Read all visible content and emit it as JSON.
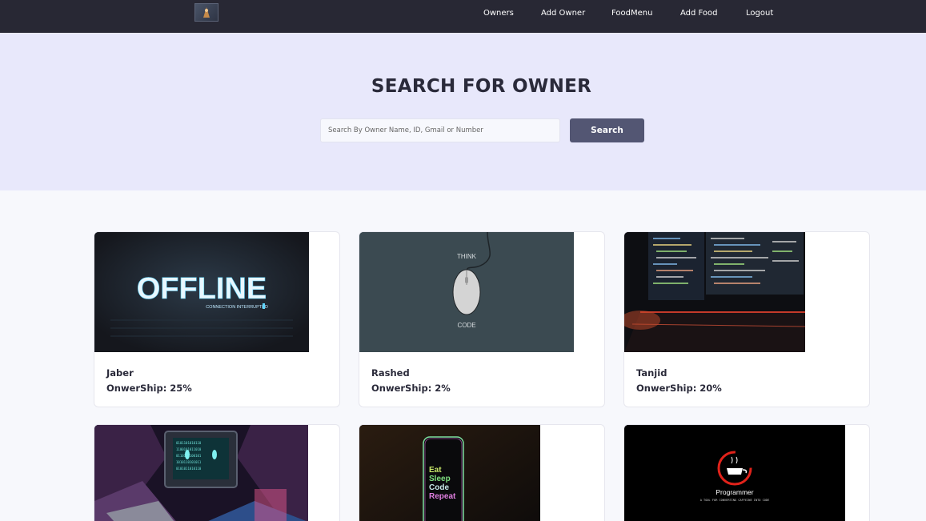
{
  "nav": {
    "links": [
      "Owners",
      "Add Owner",
      "FoodMenu",
      "Add Food",
      "Logout"
    ]
  },
  "hero": {
    "title": "SEARCH FOR OWNER",
    "search_placeholder": "Search By Owner Name, ID, Gmail or Number",
    "search_button": "Search"
  },
  "cards": [
    {
      "name": "Jaber",
      "ownership": "OnwerShip: 25%",
      "image": {
        "headline": "OFFLINE",
        "caption": "CONNECTION INTERRUPTED"
      }
    },
    {
      "name": "Rashed",
      "ownership": "OnwerShip: 2%",
      "image": {
        "top_text": "THINK",
        "bottom_text": "CODE"
      }
    },
    {
      "name": "Tanjid",
      "ownership": "OnwerShip: 20%",
      "image": {}
    },
    {
      "image": {}
    },
    {
      "image": {
        "lines": [
          "Eat",
          "Sleep",
          "Code",
          "Repeat"
        ]
      }
    },
    {
      "image": {
        "title": "Programmer",
        "caption": "A TOOL FOR CONVERTING CAFFEINE INTO CODE"
      }
    }
  ]
}
